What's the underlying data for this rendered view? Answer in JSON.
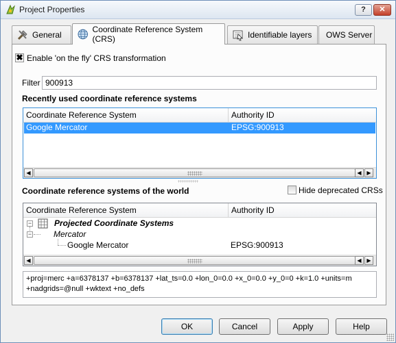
{
  "window": {
    "title": "Project Properties",
    "help_glyph": "?",
    "close_glyph": "✕"
  },
  "tabs": [
    {
      "label": "General",
      "icon": "tools-icon"
    },
    {
      "label": "Coordinate Reference System (CRS)",
      "icon": "globe-icon",
      "active": true
    },
    {
      "label": "Identifiable layers",
      "icon": "identify-icon"
    },
    {
      "label": "OWS Server"
    }
  ],
  "crs": {
    "otf_checkbox_label": "Enable 'on the fly' CRS transformation",
    "otf_checked": true,
    "filter_label": "Filter",
    "filter_value": "900913",
    "recent_heading": "Recently used coordinate reference systems",
    "recent_table": {
      "columns": [
        "Coordinate Reference System",
        "Authority ID"
      ],
      "rows": [
        {
          "name": "Google Mercator",
          "authority": "EPSG:900913",
          "selected": true
        }
      ]
    },
    "world_heading": "Coordinate reference systems of the world",
    "hide_deprecated_label": "Hide deprecated CRSs",
    "hide_deprecated_checked": false,
    "world_table": {
      "columns": [
        "Coordinate Reference System",
        "Authority ID"
      ],
      "tree": {
        "group": "Projected Coordinate Systems",
        "subgroup": "Mercator",
        "leaf": {
          "name": "Google Mercator",
          "authority": "EPSG:900913"
        }
      }
    },
    "proj_string": "+proj=merc +a=6378137 +b=6378137 +lat_ts=0.0 +lon_0=0.0 +x_0=0.0 +y_0=0 +k=1.0 +units=m +nadgrids=@null +wktext  +no_defs"
  },
  "buttons": {
    "ok": "OK",
    "cancel": "Cancel",
    "apply": "Apply",
    "help": "Help"
  },
  "colors": {
    "selection": "#3399ff",
    "focus_border": "#3b90d8"
  }
}
